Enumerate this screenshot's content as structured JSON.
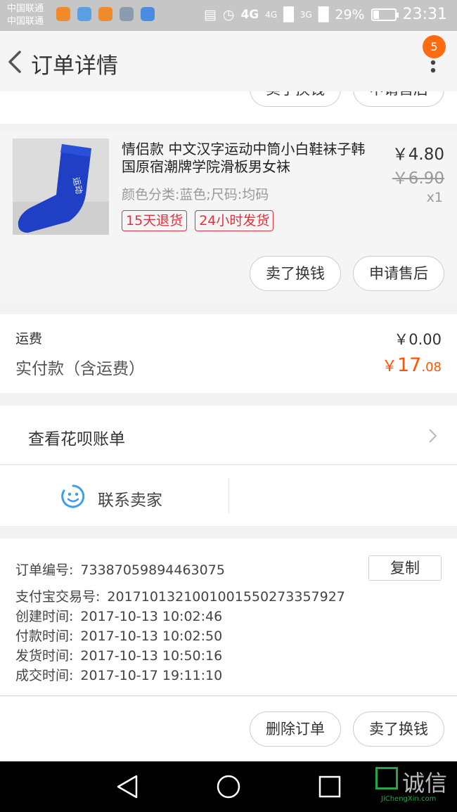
{
  "status_bar": {
    "carrier_1": "中国联通",
    "carrier_2": "中国联通",
    "app_icons": [
      "uc-browser-icon",
      "health-icon",
      "uc-browser-icon",
      "gallery-icon",
      "bird-app-icon"
    ],
    "network_1": "4G",
    "network_2": "4G",
    "network_3": "3G",
    "battery": "29%",
    "battery_level": 0.29,
    "time": "23:31"
  },
  "header": {
    "title": "订单详情",
    "badge_count": "5"
  },
  "top_actions": {
    "sell_label": "卖了换钱",
    "after_sale_label": "申请售后"
  },
  "product": {
    "title": "情侣款 中文汉字运动中筒小白鞋袜子韩国原宿潮牌学院滑板男女袜",
    "variant": "颜色分类:蓝色;尺码:均码",
    "tags": [
      "15天退货",
      "24小时发货"
    ],
    "price": "￥4.80",
    "original_price": "￥6.90",
    "quantity": "x1",
    "sell_label": "卖了换钱",
    "after_sale_label": "申请售后"
  },
  "totals": {
    "shipping_label": "运费",
    "shipping_value": "￥0.00",
    "paid_label": "实付款（含运费）",
    "paid_currency": "￥",
    "paid_integer": "17",
    "paid_decimal": ".08"
  },
  "huabei": {
    "label": "查看花呗账单"
  },
  "contact": {
    "label": "联系卖家"
  },
  "order_info": {
    "copy_label": "复制",
    "rows": [
      {
        "key": "订单编号:",
        "value": "73387059894463075"
      },
      {
        "key": "支付宝交易号:",
        "value": "2017101321001001550273357927"
      },
      {
        "key": "创建时间:",
        "value": "2017-10-13 10:02:46"
      },
      {
        "key": "付款时间:",
        "value": "2017-10-13 10:02:50"
      },
      {
        "key": "发货时间:",
        "value": "2017-10-13 10:50:16"
      },
      {
        "key": "成交时间:",
        "value": "2017-10-17 19:11:10"
      }
    ]
  },
  "bottom_actions": {
    "delete_label": "删除订单",
    "sell_label": "卖了换钱"
  },
  "watermark": {
    "text": "诚信",
    "sub": "JiChengXin.com"
  },
  "colors": {
    "accent": "#ff5500",
    "tag_red": "#e0323c",
    "badge": "#ff6b10",
    "link_blue": "#3aa0e8"
  }
}
